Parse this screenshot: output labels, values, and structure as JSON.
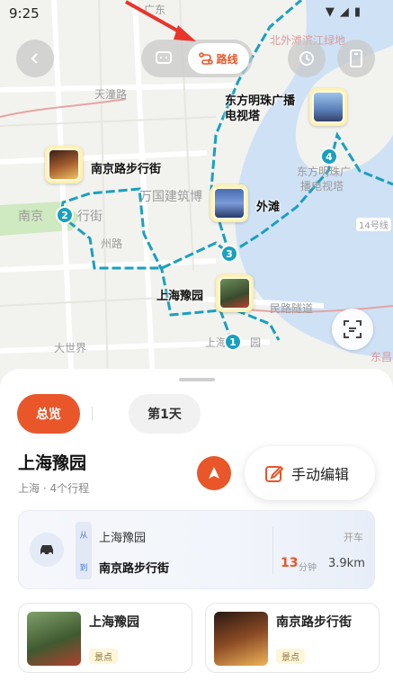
{
  "status_bar": {
    "time": "9:25",
    "icons": [
      "wifi-icon",
      "no-signal-icon",
      "battery-icon"
    ]
  },
  "top_controls": {
    "route_label": "路线"
  },
  "map": {
    "labels": {
      "tiantong_rd": "天潼路",
      "bund_greenland": "北外滩滨江绿地",
      "wanguo": "万国建筑博",
      "nanjing_rd_map": "南京",
      "hangjie": "行街",
      "da_shijie": "大世界",
      "oriental_pearl_map": "东方明珠广",
      "oriental_pearl_map2": "播电视塔",
      "yuyuan_map": "上海",
      "yuyuan_map2": "园",
      "dongchang": "东昌",
      "min_lu_tunnel": "民路隧道",
      "guangdong": "广东",
      "zhou_rd": "州路",
      "shield_14": "14号线"
    },
    "pois": [
      {
        "num": "1",
        "title": "上海豫园"
      },
      {
        "num": "2",
        "title": "南京路步行街"
      },
      {
        "num": "3",
        "title": "外滩"
      },
      {
        "num": "4",
        "title": "东方明珠广播\n电视塔"
      }
    ],
    "colors": {
      "route": "#1aa0bd",
      "water": "#cfe1f5",
      "park": "#cfe9c0"
    }
  },
  "sheet": {
    "tabs": [
      {
        "label": "总览",
        "active": true
      },
      {
        "label": "第1天",
        "active": false
      }
    ],
    "trip_title": "上海豫园",
    "trip_sub": "上海 · 4个行程",
    "edit_label": "手动编辑",
    "route": {
      "from_tag": "从",
      "to_tag": "到",
      "from": "上海豫园",
      "to": "南京路步行街",
      "mode": "开车",
      "minutes": "13",
      "minutes_unit": "分钟",
      "distance": "3.9km"
    },
    "places": [
      {
        "name": "上海豫园",
        "tag": "景点"
      },
      {
        "name": "南京路步行街",
        "tag": "景点"
      }
    ],
    "accent": "#e8562a"
  }
}
